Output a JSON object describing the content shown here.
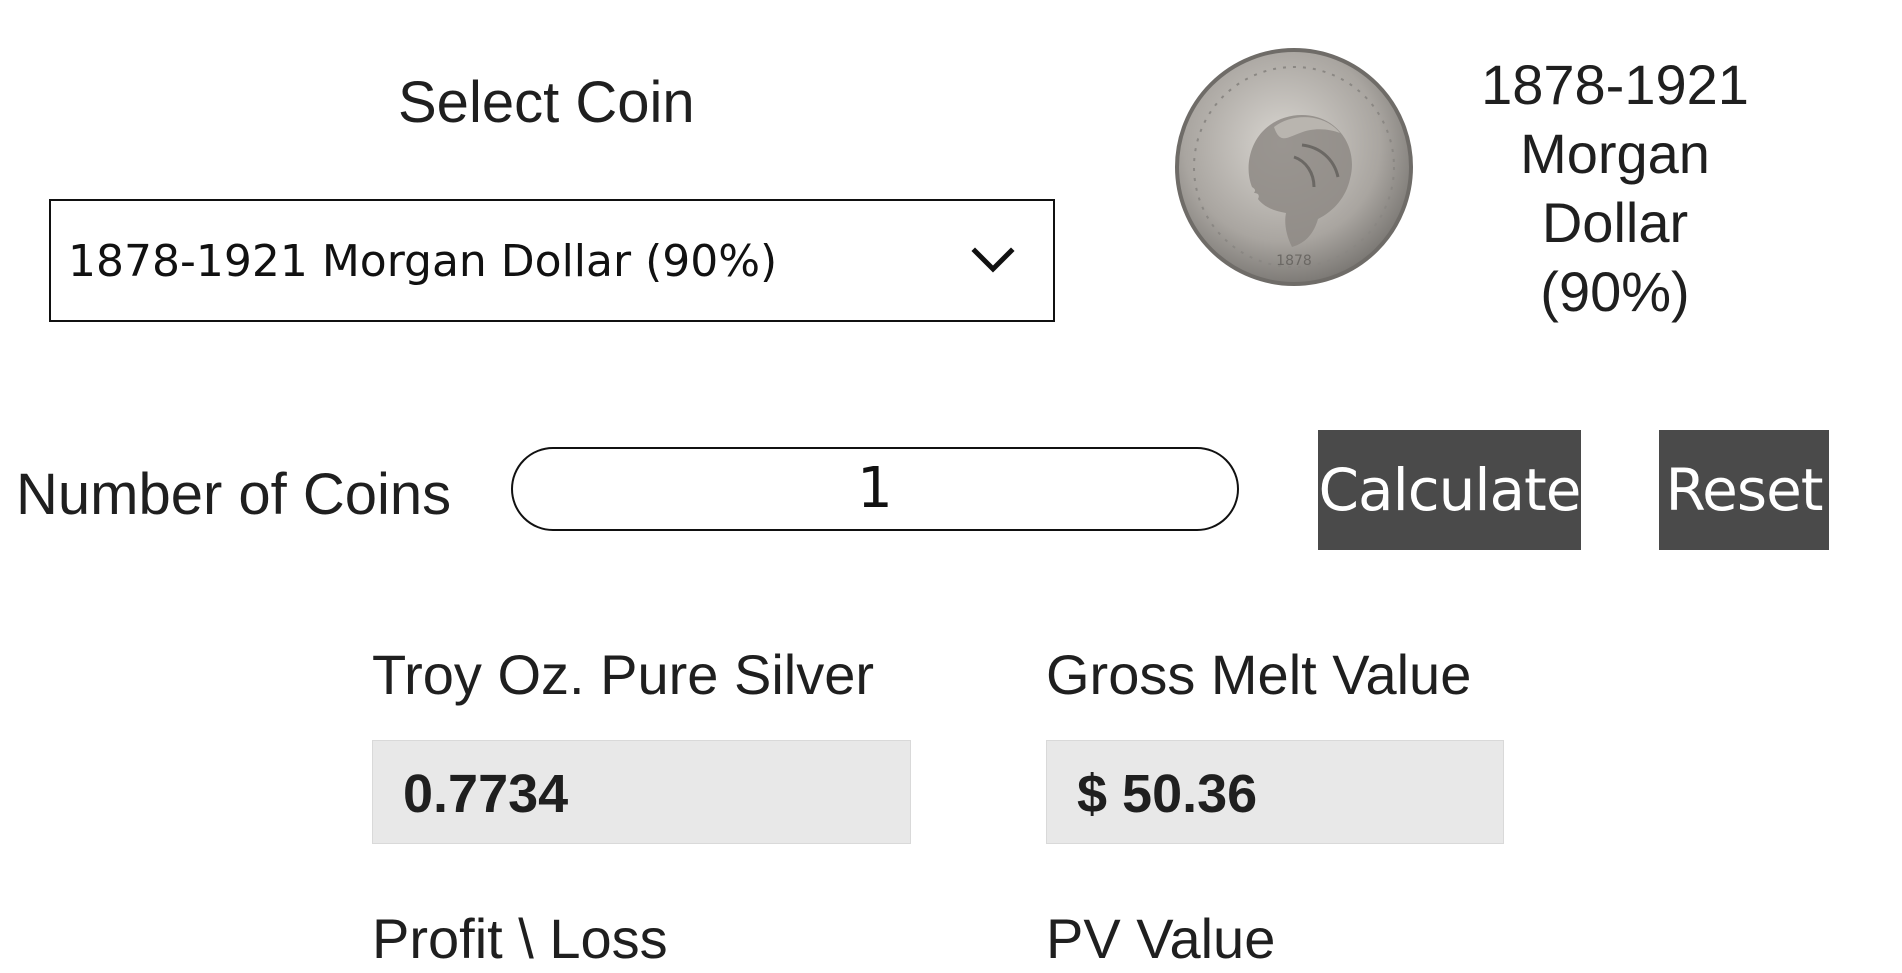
{
  "select_coin": {
    "heading": "Select Coin",
    "selected": "1878-1921 Morgan Dollar (90%)",
    "chevron_icon": "chevron-down-icon"
  },
  "coin_preview": {
    "image_icon": "coin-image",
    "name_lines": [
      "1878-1921",
      "Morgan",
      "Dollar",
      "(90%)"
    ]
  },
  "count": {
    "label": "Number of Coins",
    "value": "1"
  },
  "buttons": {
    "calculate": "Calculate",
    "reset": "Reset"
  },
  "results": {
    "troy_label": "Troy Oz. Pure Silver",
    "troy_value": "0.7734",
    "melt_label": "Gross Melt Value",
    "melt_value": "$ 50.36",
    "profit_label": "Profit \\ Loss",
    "pv_label": "PV Value"
  },
  "colors": {
    "button_bg": "#4a4a4a",
    "output_bg": "#e8e8e8"
  }
}
